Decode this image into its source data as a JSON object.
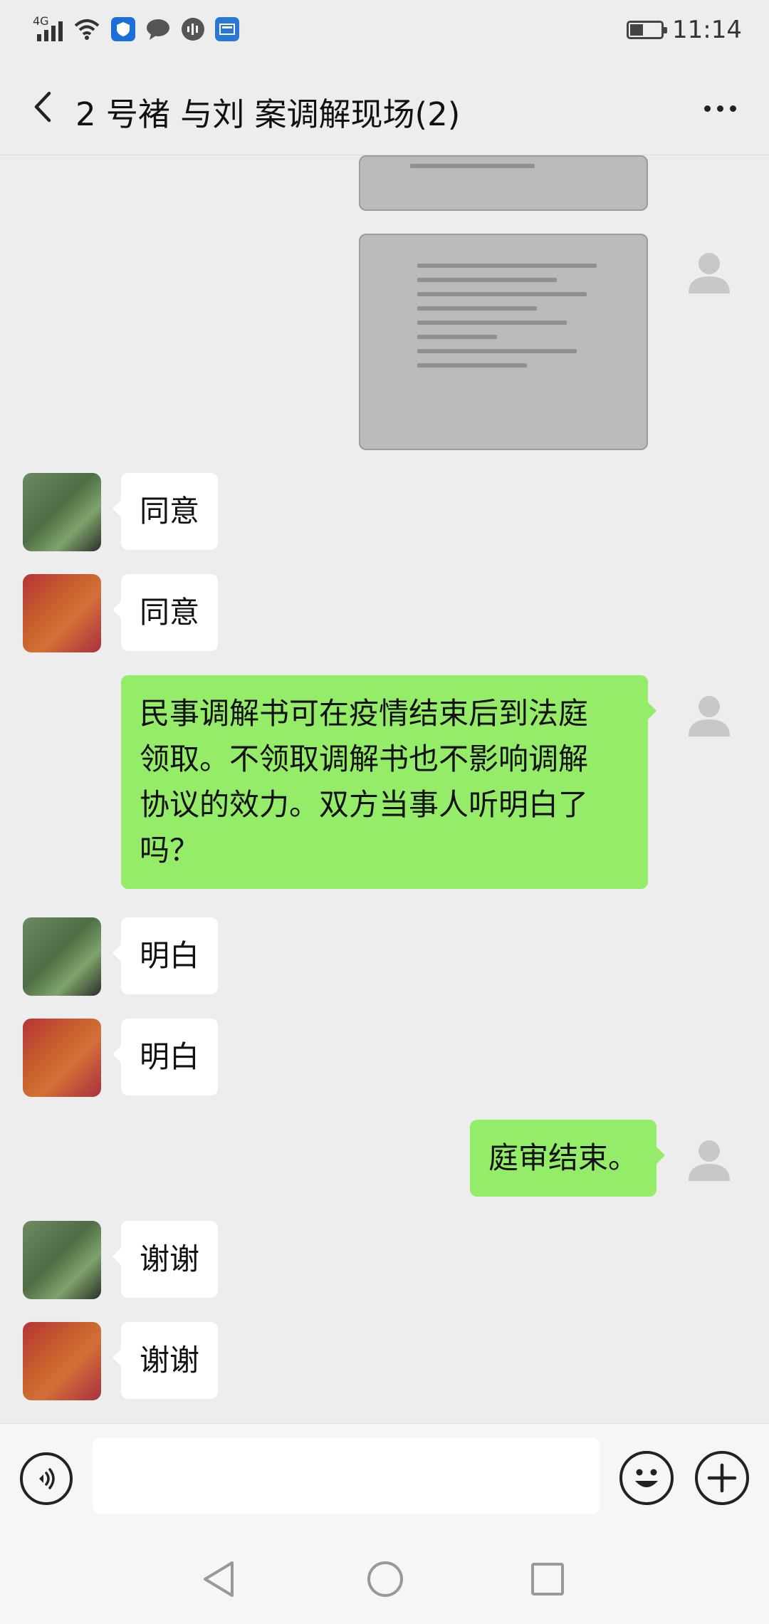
{
  "status_bar": {
    "network": "4G",
    "time": "11:14"
  },
  "header": {
    "title": "2   号褚     与刘     案调解现场(2)"
  },
  "messages": [
    {
      "type": "image",
      "side": "out"
    },
    {
      "type": "image",
      "side": "out"
    },
    {
      "type": "text",
      "side": "in",
      "text": "同意"
    },
    {
      "type": "text",
      "side": "in",
      "text": "同意"
    },
    {
      "type": "text",
      "side": "out",
      "lines": [
        "民事调解书可在疫情结束后到法庭",
        "领取。不领取调解书也不影响调解",
        "协议的效力。双方当事人听明白了",
        "吗？"
      ]
    },
    {
      "type": "text",
      "side": "in",
      "text": "明白"
    },
    {
      "type": "text",
      "side": "in",
      "text": "明白"
    },
    {
      "type": "text",
      "side": "out",
      "text": "庭审结束。"
    },
    {
      "type": "text",
      "side": "in",
      "text": "谢谢"
    },
    {
      "type": "text",
      "side": "in",
      "text": "谢谢"
    }
  ],
  "input": {
    "value": ""
  },
  "icons": {
    "back": "chevron-left-icon",
    "more": "more-dots-icon",
    "voice": "voice-icon",
    "emoji": "emoji-icon",
    "plus": "plus-icon",
    "nav_back": "triangle-back-icon",
    "nav_home": "circle-home-icon",
    "nav_recent": "square-recent-icon"
  },
  "colors": {
    "background": "#ededed",
    "bubble_out": "#95ec69",
    "bubble_in": "#ffffff"
  }
}
